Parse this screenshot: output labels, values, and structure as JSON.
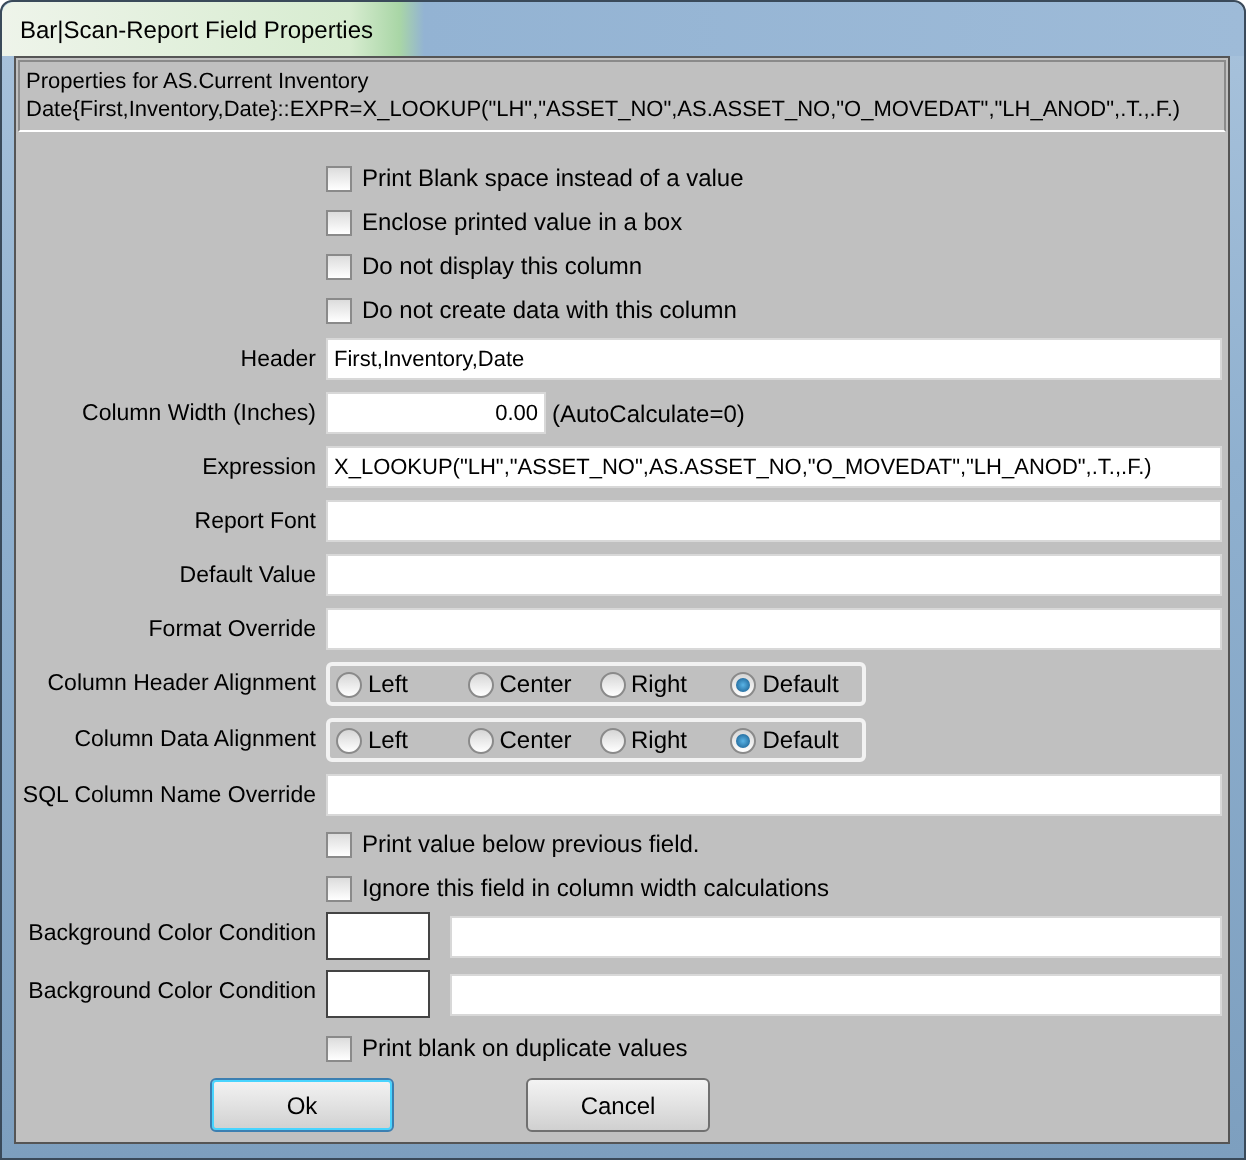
{
  "window": {
    "title": "Bar|Scan-Report Field Properties"
  },
  "description": [
    "Properties for AS.Current Inventory",
    "Date{First,Inventory,Date}::EXPR=X_LOOKUP(\"LH\",\"ASSET_NO\",AS.ASSET_NO,\"O_MOVEDAT\",\"LH_ANOD\",.T.,.F.)"
  ],
  "rows": [
    {
      "kind": "check",
      "label": "Print Blank space instead of a value",
      "checked": false
    },
    {
      "kind": "check",
      "label": "Enclose printed value in a box",
      "checked": false
    },
    {
      "kind": "check",
      "label": "Do not display this column",
      "checked": false
    },
    {
      "kind": "check",
      "label": "Do not create data with this column",
      "checked": false
    },
    {
      "kind": "text",
      "label": "Header",
      "value": "First,Inventory,Date"
    },
    {
      "kind": "number",
      "label": "Column Width (Inches)",
      "value": "0.00",
      "note": "(AutoCalculate=0)"
    },
    {
      "kind": "text",
      "label": "Expression",
      "value": "X_LOOKUP(\"LH\",\"ASSET_NO\",AS.ASSET_NO,\"O_MOVEDAT\",\"LH_ANOD\",.T.,.F.)"
    },
    {
      "kind": "text",
      "label": "Report Font"
    },
    {
      "kind": "text",
      "label": "Default Value"
    },
    {
      "kind": "text",
      "label": "Format Override"
    },
    {
      "kind": "radio",
      "label": "Column Header Alignment",
      "options": [
        {
          "label": "Left",
          "selected": false
        },
        {
          "label": "Center",
          "selected": false
        },
        {
          "label": "Right",
          "selected": false
        },
        {
          "label": "Default",
          "selected": true
        }
      ]
    },
    {
      "kind": "radio",
      "label": "Column Data Alignment",
      "options": [
        {
          "label": "Left",
          "selected": false
        },
        {
          "label": "Center",
          "selected": false
        },
        {
          "label": "Right",
          "selected": false
        },
        {
          "label": "Default",
          "selected": true
        }
      ]
    },
    {
      "kind": "text",
      "label": "SQL Column Name Override"
    },
    {
      "kind": "check",
      "label": "Print value below previous field.",
      "checked": false
    },
    {
      "kind": "check",
      "label": "Ignore this field in column width calculations",
      "checked": false
    },
    {
      "kind": "color",
      "label": "Background Color Condition"
    },
    {
      "kind": "color",
      "label": "Background Color Condition"
    },
    {
      "kind": "check",
      "label": "Print blank on duplicate values",
      "checked": false
    }
  ],
  "buttons": [
    {
      "label": "Ok",
      "default": true
    },
    {
      "label": "Cancel",
      "default": false
    }
  ]
}
